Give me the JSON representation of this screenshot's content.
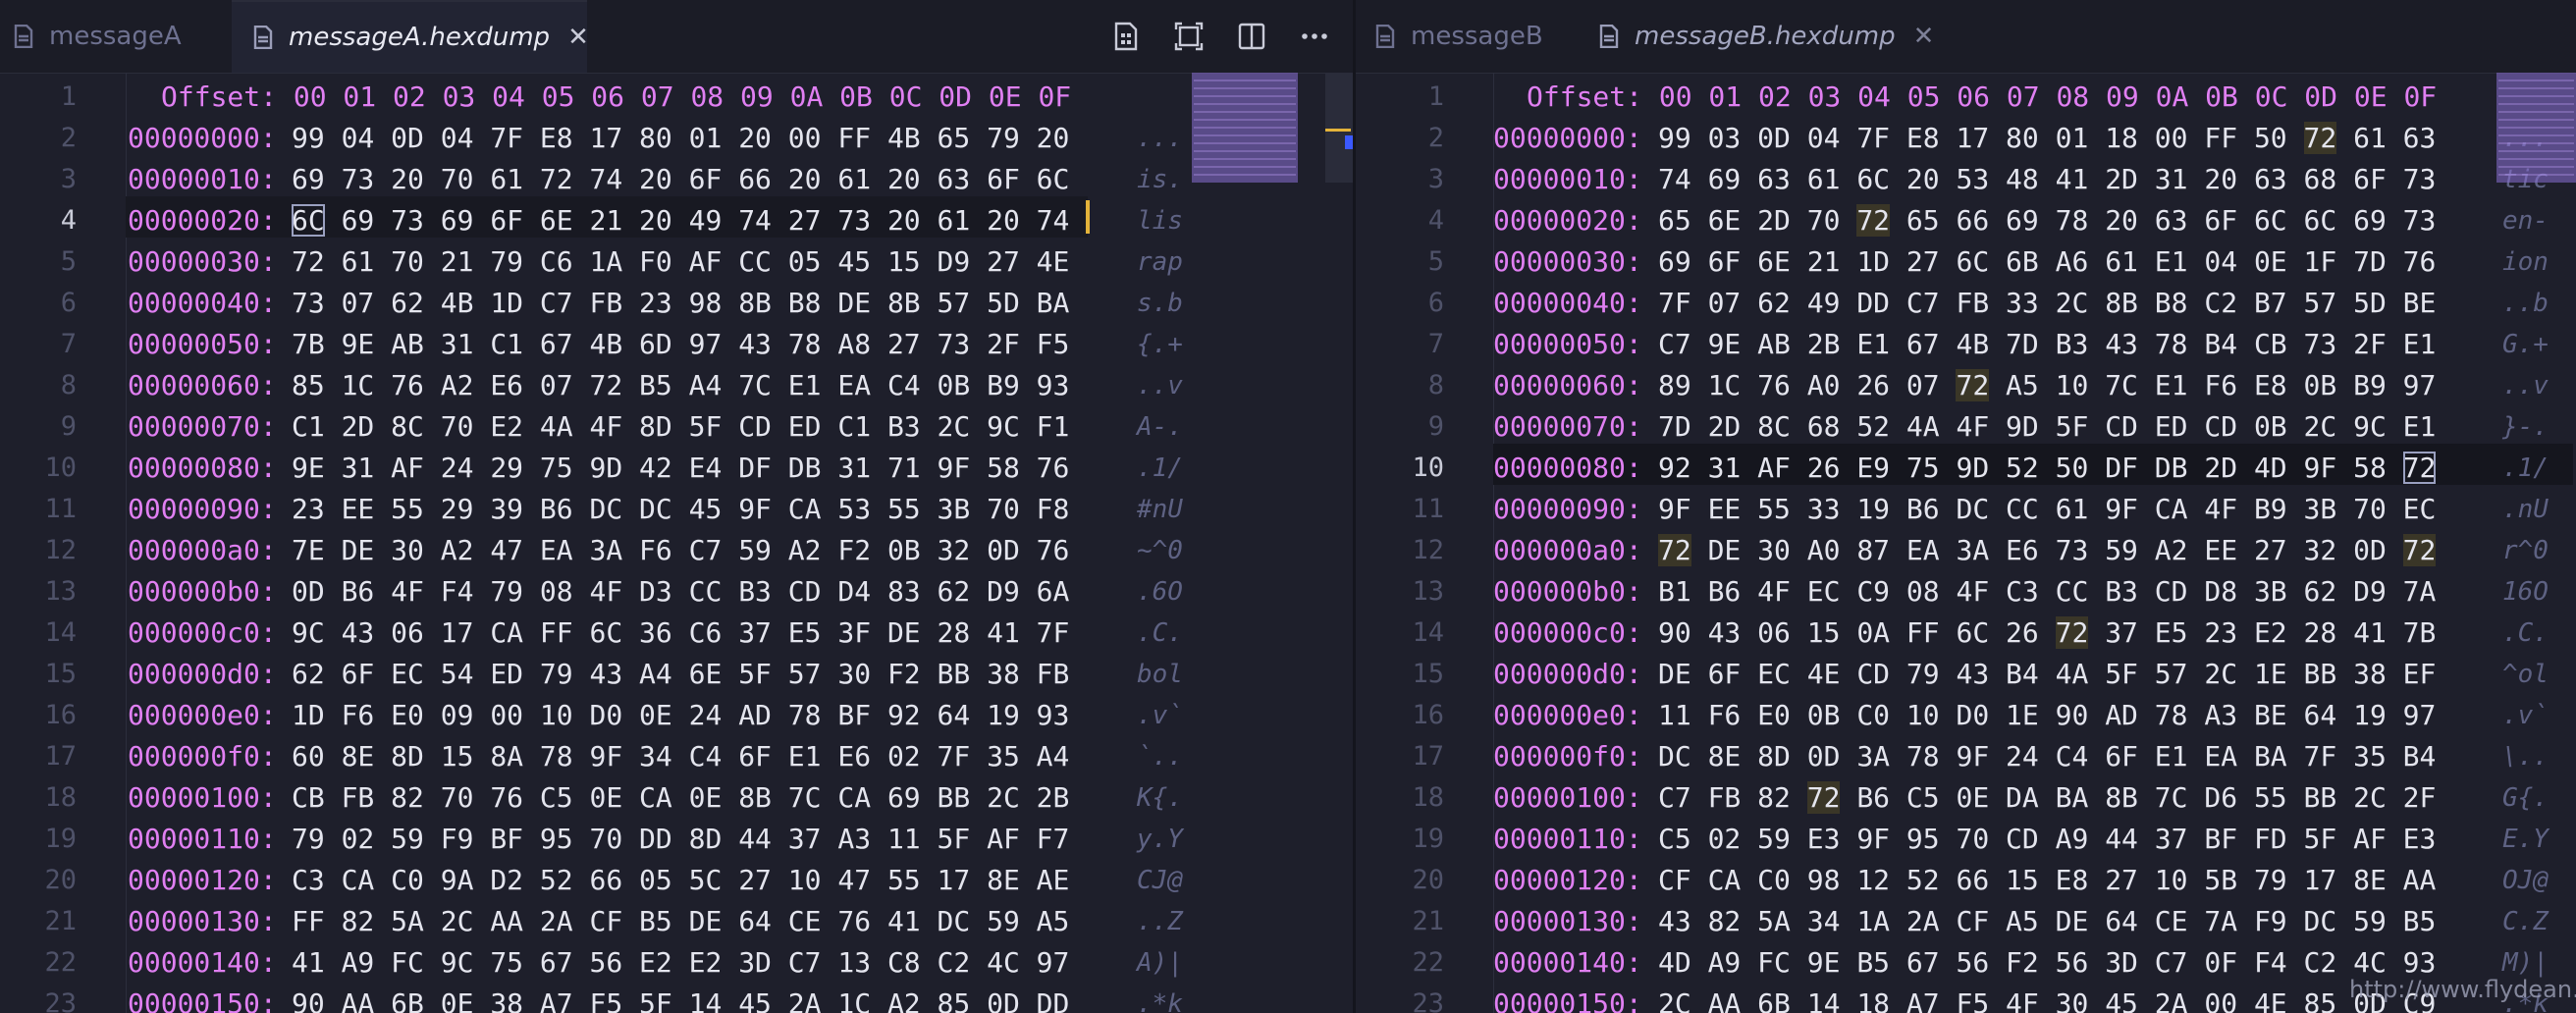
{
  "left": {
    "tabs": [
      {
        "label": "messageA",
        "active": false
      },
      {
        "label": "messageA.hexdump",
        "active": true
      }
    ],
    "header": "Offset: 00 01 02 03 04 05 06 07 08 09 0A 0B 0C 0D 0E 0F",
    "current_line": 4,
    "rows": [
      {
        "n": "2",
        "off": "00000000:",
        "hex": "99 04 0D 04 7F E8 17 80 01 20 00 FF 4B 65 79 20",
        "ascii": "..."
      },
      {
        "n": "3",
        "off": "00000010:",
        "hex": "69 73 20 70 61 72 74 20 6F 66 20 61 20 63 6F 6C",
        "ascii": "is."
      },
      {
        "n": "4",
        "off": "00000020:",
        "hex": "6C 69 73 69 6F 6E 21 20 49 74 27 73 20 61 20 74",
        "ascii": "lis"
      },
      {
        "n": "5",
        "off": "00000030:",
        "hex": "72 61 70 21 79 C6 1A F0 AF CC 05 45 15 D9 27 4E",
        "ascii": "rap"
      },
      {
        "n": "6",
        "off": "00000040:",
        "hex": "73 07 62 4B 1D C7 FB 23 98 8B B8 DE 8B 57 5D BA",
        "ascii": "s.b"
      },
      {
        "n": "7",
        "off": "00000050:",
        "hex": "7B 9E AB 31 C1 67 4B 6D 97 43 78 A8 27 73 2F F5",
        "ascii": "{.+"
      },
      {
        "n": "8",
        "off": "00000060:",
        "hex": "85 1C 76 A2 E6 07 72 B5 A4 7C E1 EA C4 0B B9 93",
        "ascii": "..v"
      },
      {
        "n": "9",
        "off": "00000070:",
        "hex": "C1 2D 8C 70 E2 4A 4F 8D 5F CD ED C1 B3 2C 9C F1",
        "ascii": "A-."
      },
      {
        "n": "10",
        "off": "00000080:",
        "hex": "9E 31 AF 24 29 75 9D 42 E4 DF DB 31 71 9F 58 76",
        "ascii": ".1/"
      },
      {
        "n": "11",
        "off": "00000090:",
        "hex": "23 EE 55 29 39 B6 DC DC 45 9F CA 53 55 3B 70 F8",
        "ascii": "#nU"
      },
      {
        "n": "12",
        "off": "000000a0:",
        "hex": "7E DE 30 A2 47 EA 3A F6 C7 59 A2 F2 0B 32 0D 76",
        "ascii": "~^0"
      },
      {
        "n": "13",
        "off": "000000b0:",
        "hex": "0D B6 4F F4 79 08 4F D3 CC B3 CD D4 83 62 D9 6A",
        "ascii": ".6O"
      },
      {
        "n": "14",
        "off": "000000c0:",
        "hex": "9C 43 06 17 CA FF 6C 36 C6 37 E5 3F DE 28 41 7F",
        "ascii": ".C."
      },
      {
        "n": "15",
        "off": "000000d0:",
        "hex": "62 6F EC 54 ED 79 43 A4 6E 5F 57 30 F2 BB 38 FB",
        "ascii": "bol"
      },
      {
        "n": "16",
        "off": "000000e0:",
        "hex": "1D F6 E0 09 00 10 D0 0E 24 AD 78 BF 92 64 19 93",
        "ascii": ".v`"
      },
      {
        "n": "17",
        "off": "000000f0:",
        "hex": "60 8E 8D 15 8A 78 9F 34 C4 6F E1 E6 02 7F 35 A4",
        "ascii": "`.."
      },
      {
        "n": "18",
        "off": "00000100:",
        "hex": "CB FB 82 70 76 C5 0E CA 0E 8B 7C CA 69 BB 2C 2B",
        "ascii": "K{."
      },
      {
        "n": "19",
        "off": "00000110:",
        "hex": "79 02 59 F9 BF 95 70 DD 8D 44 37 A3 11 5F AF F7",
        "ascii": "y.Y"
      },
      {
        "n": "20",
        "off": "00000120:",
        "hex": "C3 CA C0 9A D2 52 66 05 5C 27 10 47 55 17 8E AE",
        "ascii": "CJ@"
      },
      {
        "n": "21",
        "off": "00000130:",
        "hex": "FF 82 5A 2C AA 2A CF B5 DE 64 CE 76 41 DC 59 A5",
        "ascii": "..Z"
      },
      {
        "n": "22",
        "off": "00000140:",
        "hex": "41 A9 FC 9C 75 67 56 E2 E2 3D C7 13 C8 C2 4C 97",
        "ascii": "A)|"
      },
      {
        "n": "23",
        "off": "00000150:",
        "hex": "90 AA 6B 0E 38 A7 F5 5F 14 45 2A 1C A2 85 0D DD",
        "ascii": ".*k"
      }
    ]
  },
  "right": {
    "tabs": [
      {
        "label": "messageB",
        "active": false
      },
      {
        "label": "messageB.hexdump",
        "active": false
      }
    ],
    "header": "Offset: 00 01 02 03 04 05 06 07 08 09 0A 0B 0C 0D 0E 0F",
    "current_line": 10,
    "rows": [
      {
        "n": "2",
        "off": "00000000:",
        "hex": "99 03 0D 04 7F E8 17 80 01 18 00 FF 50 72 61 63",
        "ascii": "..."
      },
      {
        "n": "3",
        "off": "00000010:",
        "hex": "74 69 63 61 6C 20 53 48 41 2D 31 20 63 68 6F 73",
        "ascii": "tic"
      },
      {
        "n": "4",
        "off": "00000020:",
        "hex": "65 6E 2D 70 72 65 66 69 78 20 63 6F 6C 6C 69 73",
        "ascii": "en-"
      },
      {
        "n": "5",
        "off": "00000030:",
        "hex": "69 6F 6E 21 1D 27 6C 6B A6 61 E1 04 0E 1F 7D 76",
        "ascii": "ion"
      },
      {
        "n": "6",
        "off": "00000040:",
        "hex": "7F 07 62 49 DD C7 FB 33 2C 8B B8 C2 B7 57 5D BE",
        "ascii": "..b"
      },
      {
        "n": "7",
        "off": "00000050:",
        "hex": "C7 9E AB 2B E1 67 4B 7D B3 43 78 B4 CB 73 2F E1",
        "ascii": "G.+"
      },
      {
        "n": "8",
        "off": "00000060:",
        "hex": "89 1C 76 A0 26 07 72 A5 10 7C E1 F6 E8 0B B9 97",
        "ascii": "..v"
      },
      {
        "n": "9",
        "off": "00000070:",
        "hex": "7D 2D 8C 68 52 4A 4F 9D 5F CD ED CD 0B 2C 9C E1",
        "ascii": "}-."
      },
      {
        "n": "10",
        "off": "00000080:",
        "hex": "92 31 AF 26 E9 75 9D 52 50 DF DB 2D 4D 9F 58 72",
        "ascii": ".1/"
      },
      {
        "n": "11",
        "off": "00000090:",
        "hex": "9F EE 55 33 19 B6 DC CC 61 9F CA 4F B9 3B 70 EC",
        "ascii": ".nU"
      },
      {
        "n": "12",
        "off": "000000a0:",
        "hex": "72 DE 30 A0 87 EA 3A E6 73 59 A2 EE 27 32 0D 72",
        "ascii": "r^0"
      },
      {
        "n": "13",
        "off": "000000b0:",
        "hex": "B1 B6 4F EC C9 08 4F C3 CC B3 CD D8 3B 62 D9 7A",
        "ascii": "16O"
      },
      {
        "n": "14",
        "off": "000000c0:",
        "hex": "90 43 06 15 0A FF 6C 26 72 37 E5 23 E2 28 41 7B",
        "ascii": ".C."
      },
      {
        "n": "15",
        "off": "000000d0:",
        "hex": "DE 6F EC 4E CD 79 43 B4 4A 5F 57 2C 1E BB 38 EF",
        "ascii": "^ol"
      },
      {
        "n": "16",
        "off": "000000e0:",
        "hex": "11 F6 E0 0B C0 10 D0 1E 90 AD 78 A3 BE 64 19 97",
        "ascii": ".v`"
      },
      {
        "n": "17",
        "off": "000000f0:",
        "hex": "DC 8E 8D 0D 3A 78 9F 24 C4 6F E1 EA BA 7F 35 B4",
        "ascii": "\\.."
      },
      {
        "n": "18",
        "off": "00000100:",
        "hex": "C7 FB 82 72 B6 C5 0E DA BA 8B 7C D6 55 BB 2C 2F",
        "ascii": "G{."
      },
      {
        "n": "19",
        "off": "00000110:",
        "hex": "C5 02 59 E3 9F 95 70 CD A9 44 37 BF FD 5F AF E3",
        "ascii": "E.Y"
      },
      {
        "n": "20",
        "off": "00000120:",
        "hex": "CF CA C0 98 12 52 66 15 E8 27 10 5B 79 17 8E AA",
        "ascii": "OJ@"
      },
      {
        "n": "21",
        "off": "00000130:",
        "hex": "43 82 5A 34 1A 2A CF A5 DE 64 CE 7A F9 DC 59 B5",
        "ascii": "C.Z"
      },
      {
        "n": "22",
        "off": "00000140:",
        "hex": "4D A9 FC 9E B5 67 56 F2 56 3D C7 0F F4 C2 4C 93",
        "ascii": "M)|"
      },
      {
        "n": "23",
        "off": "00000150:",
        "hex": "2C AA 6B 14 18 A7 F5 4F 30 45 2A 00 4E 85 0D C9",
        "ascii": ".*k"
      }
    ]
  },
  "watermark": "http://www.flydean.com",
  "colors": {
    "offset": "#e07ff2",
    "hex": "#e4e5ee",
    "ascii": "#5e6283",
    "background": "#1e1f2b",
    "accent": "#e4b33a"
  }
}
